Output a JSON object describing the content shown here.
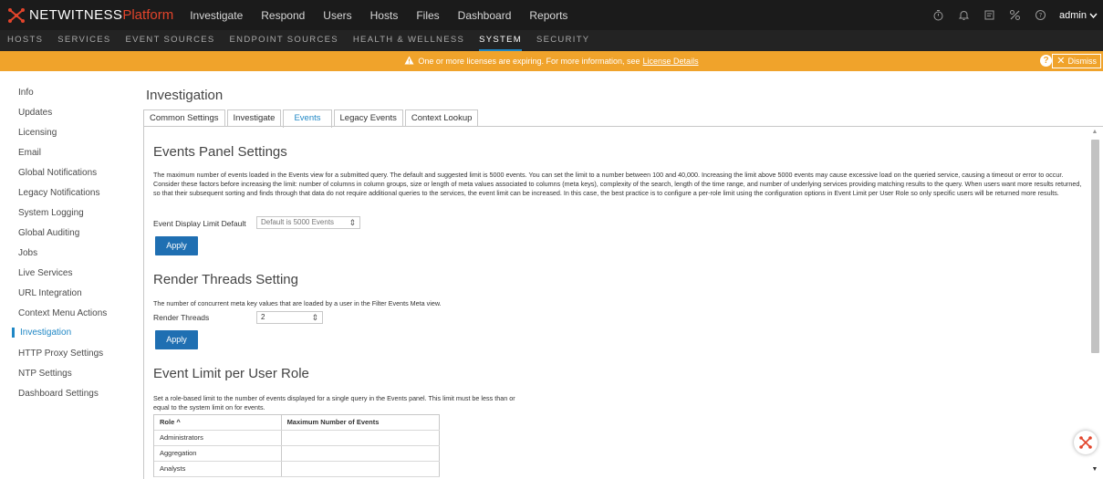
{
  "brand": {
    "name_a": "NETWITNESS",
    "name_b": "Platform",
    "accent": "#e2442b"
  },
  "main_nav": [
    "Investigate",
    "Respond",
    "Users",
    "Hosts",
    "Files",
    "Dashboard",
    "Reports"
  ],
  "top_icons": [
    "timer-icon",
    "bell-icon",
    "notes-icon",
    "tools-icon",
    "help-icon"
  ],
  "user": {
    "name": "admin"
  },
  "sub_nav": {
    "items": [
      "HOSTS",
      "SERVICES",
      "EVENT SOURCES",
      "ENDPOINT SOURCES",
      "HEALTH & WELLNESS",
      "SYSTEM",
      "SECURITY"
    ],
    "active": "SYSTEM"
  },
  "banner": {
    "message": "One or more licenses are expiring. For more information, see",
    "link": "License Details",
    "dismiss": "Dismiss",
    "help": "?",
    "color": "#f0a32b"
  },
  "sidebar": {
    "items": [
      "Info",
      "Updates",
      "Licensing",
      "Email",
      "Global Notifications",
      "Legacy Notifications",
      "System Logging",
      "Global Auditing",
      "Jobs",
      "Live Services",
      "URL Integration",
      "Context Menu Actions",
      "Investigation",
      "HTTP Proxy Settings",
      "NTP Settings",
      "Dashboard Settings"
    ],
    "active": "Investigation"
  },
  "page": {
    "title": "Investigation"
  },
  "tabs": {
    "items": [
      "Common Settings",
      "Investigate",
      "Events",
      "Legacy Events",
      "Context Lookup"
    ],
    "active": "Events"
  },
  "events_panel": {
    "title": "Events Panel Settings",
    "description": "The maximum number of events loaded in the Events view for a submitted query. The default and suggested limit is 5000 events. You can set the limit to a number between 100 and 40,000. Increasing the limit above 5000 events may cause excessive load on the queried service, causing a timeout or error to occur. Consider these factors before increasing the limit: number of columns in column groups, size or length of meta values associated to columns (meta keys), complexity of the search, length of the time range, and number of underlying services providing matching results to the query. When users want more results returned, so that their subsequent sorting and finds through that data do not require additional queries to the services, the event limit can be increased. In this case, the best practice is to configure a per-role limit using the configuration options in Event Limit per User Role so only specific users will be returned more results.",
    "field_label": "Event Display Limit Default",
    "field_placeholder": "Default is 5000 Events",
    "apply": "Apply"
  },
  "render_threads": {
    "title": "Render Threads Setting",
    "description": "The number of concurrent meta key values that are loaded by a user in the Filter Events Meta view.",
    "field_label": "Render Threads",
    "field_value": "2",
    "apply": "Apply"
  },
  "event_limit": {
    "title": "Event Limit per User Role",
    "description": "Set a role-based limit to the number of events displayed for a single query in the Events panel. This limit must be less than or equal to the system limit on for events.",
    "columns": [
      "Role ^",
      "Maximum Number of Events"
    ],
    "rows": [
      "Administrators",
      "Aggregation",
      "Analysts"
    ]
  }
}
